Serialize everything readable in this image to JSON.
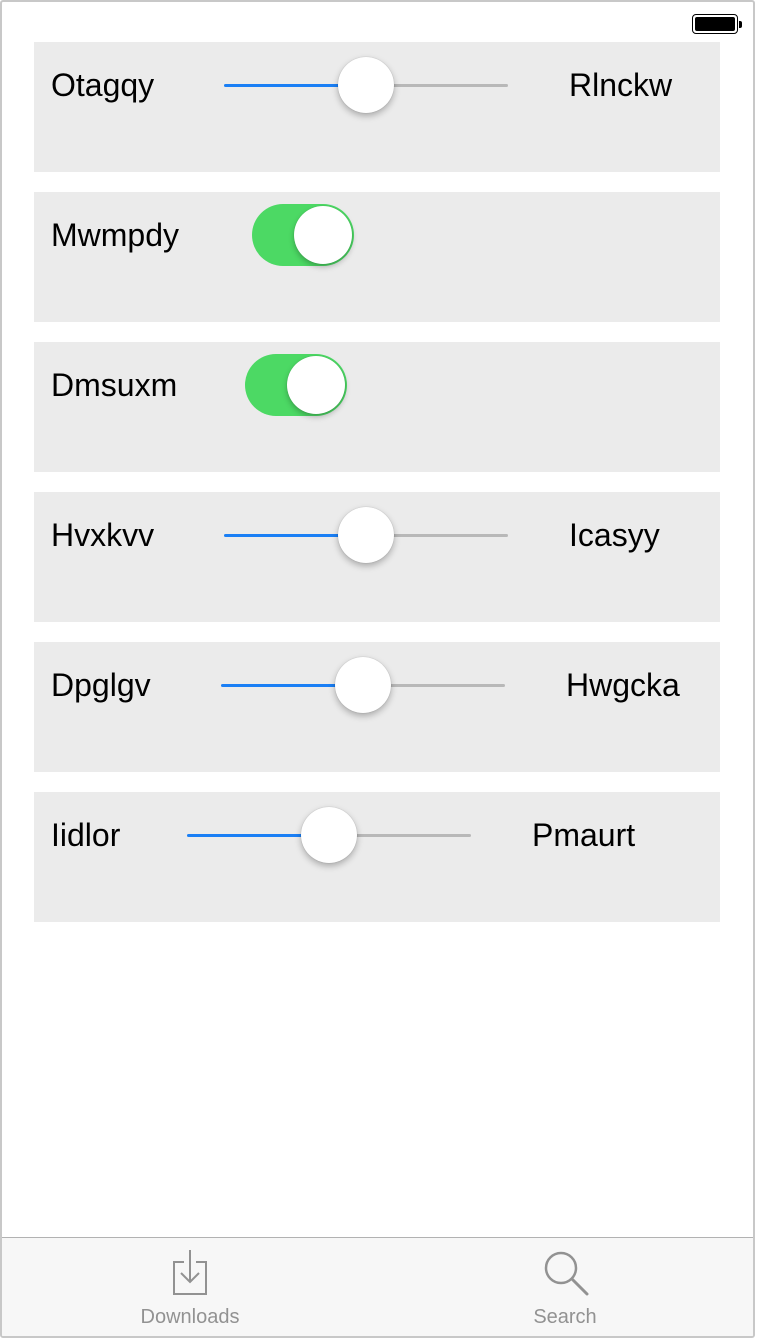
{
  "rows": [
    {
      "kind": "slider",
      "label": "Otagqy",
      "right_label": "Rlnckw",
      "value": 0.5
    },
    {
      "kind": "toggle",
      "label": "Mwmpdy",
      "on": true
    },
    {
      "kind": "toggle",
      "label": "Dmsuxm",
      "on": true
    },
    {
      "kind": "slider",
      "label": "Hvxkvv",
      "right_label": "Icasyy",
      "value": 0.5
    },
    {
      "kind": "slider",
      "label": "Dpglgv",
      "right_label": "Hwgcka",
      "value": 0.5
    },
    {
      "kind": "slider",
      "label": "Iidlor",
      "right_label": "Pmaurt",
      "value": 0.5
    }
  ],
  "tabbar": {
    "tabs": [
      {
        "label": "Downloads",
        "icon": "downloads-icon"
      },
      {
        "label": "Search",
        "icon": "search-icon"
      }
    ]
  },
  "colors": {
    "slider_min_track": "#1a7ff5",
    "slider_max_track": "#b8b8b8",
    "toggle_on": "#4cd964",
    "row_background": "#ebebeb"
  }
}
